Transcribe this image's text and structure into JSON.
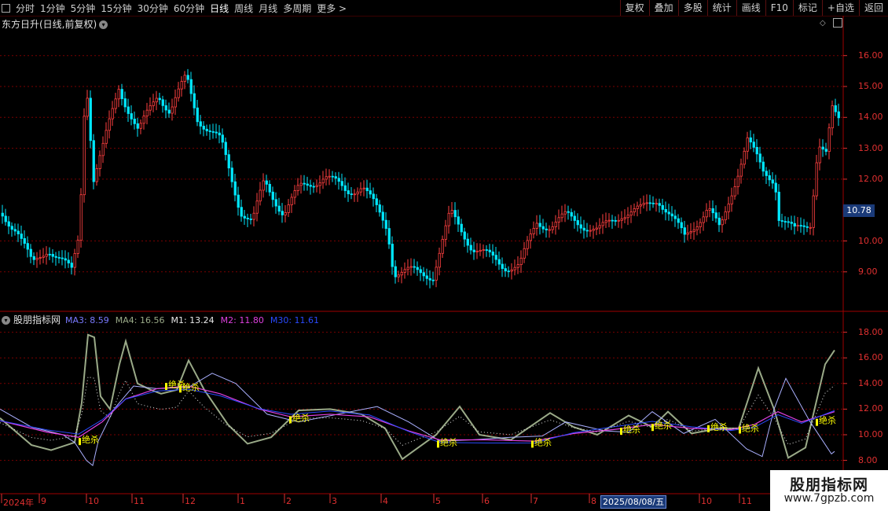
{
  "toolbar": {
    "periods": [
      "分时",
      "1分钟",
      "5分钟",
      "15分钟",
      "30分钟",
      "60分钟",
      "日线",
      "周线",
      "月线",
      "多周期",
      "更多 >"
    ],
    "active_period": "日线",
    "right_buttons": [
      "复权",
      "叠加",
      "多股",
      "统计",
      "画线",
      "F10",
      "标记",
      "+自选",
      "返回"
    ]
  },
  "main_chart": {
    "title": "东方日升(日线,前复权)",
    "y_ticks": [
      "16.00",
      "15.00",
      "14.00",
      "13.00",
      "12.00",
      "10.00",
      "9.00"
    ],
    "current_price": "10.78"
  },
  "indicator": {
    "name": "股朋指标网",
    "legend": [
      {
        "label": "MA3: 8.59",
        "color": "#7a7aff"
      },
      {
        "label": "MA4: 16.56",
        "color": "#9aaa88"
      },
      {
        "label": "M1: 13.24",
        "color": "#e8e8e8"
      },
      {
        "label": "M2: 11.80",
        "color": "#e040e0"
      },
      {
        "label": "M30: 11.61",
        "color": "#2a4aff"
      }
    ],
    "y_ticks": [
      "18.00",
      "16.00",
      "14.00",
      "12.00",
      "10.00",
      "8.00"
    ],
    "signal_label": "绝杀"
  },
  "date_axis": {
    "labels": [
      "2024年",
      "9",
      "10",
      "11",
      "12",
      "1",
      "2",
      "3",
      "4",
      "5",
      "6",
      "7",
      "8",
      "10",
      "11"
    ],
    "highlight": "2025/08/08/五"
  },
  "watermark": {
    "title": "股朋指标网",
    "url": "www.7gpzb.com"
  },
  "colors": {
    "up": "#ff4040",
    "down": "#00e8ff",
    "grid": "#7a0000",
    "axis": "#e03030",
    "signal": "#ffff00"
  }
}
